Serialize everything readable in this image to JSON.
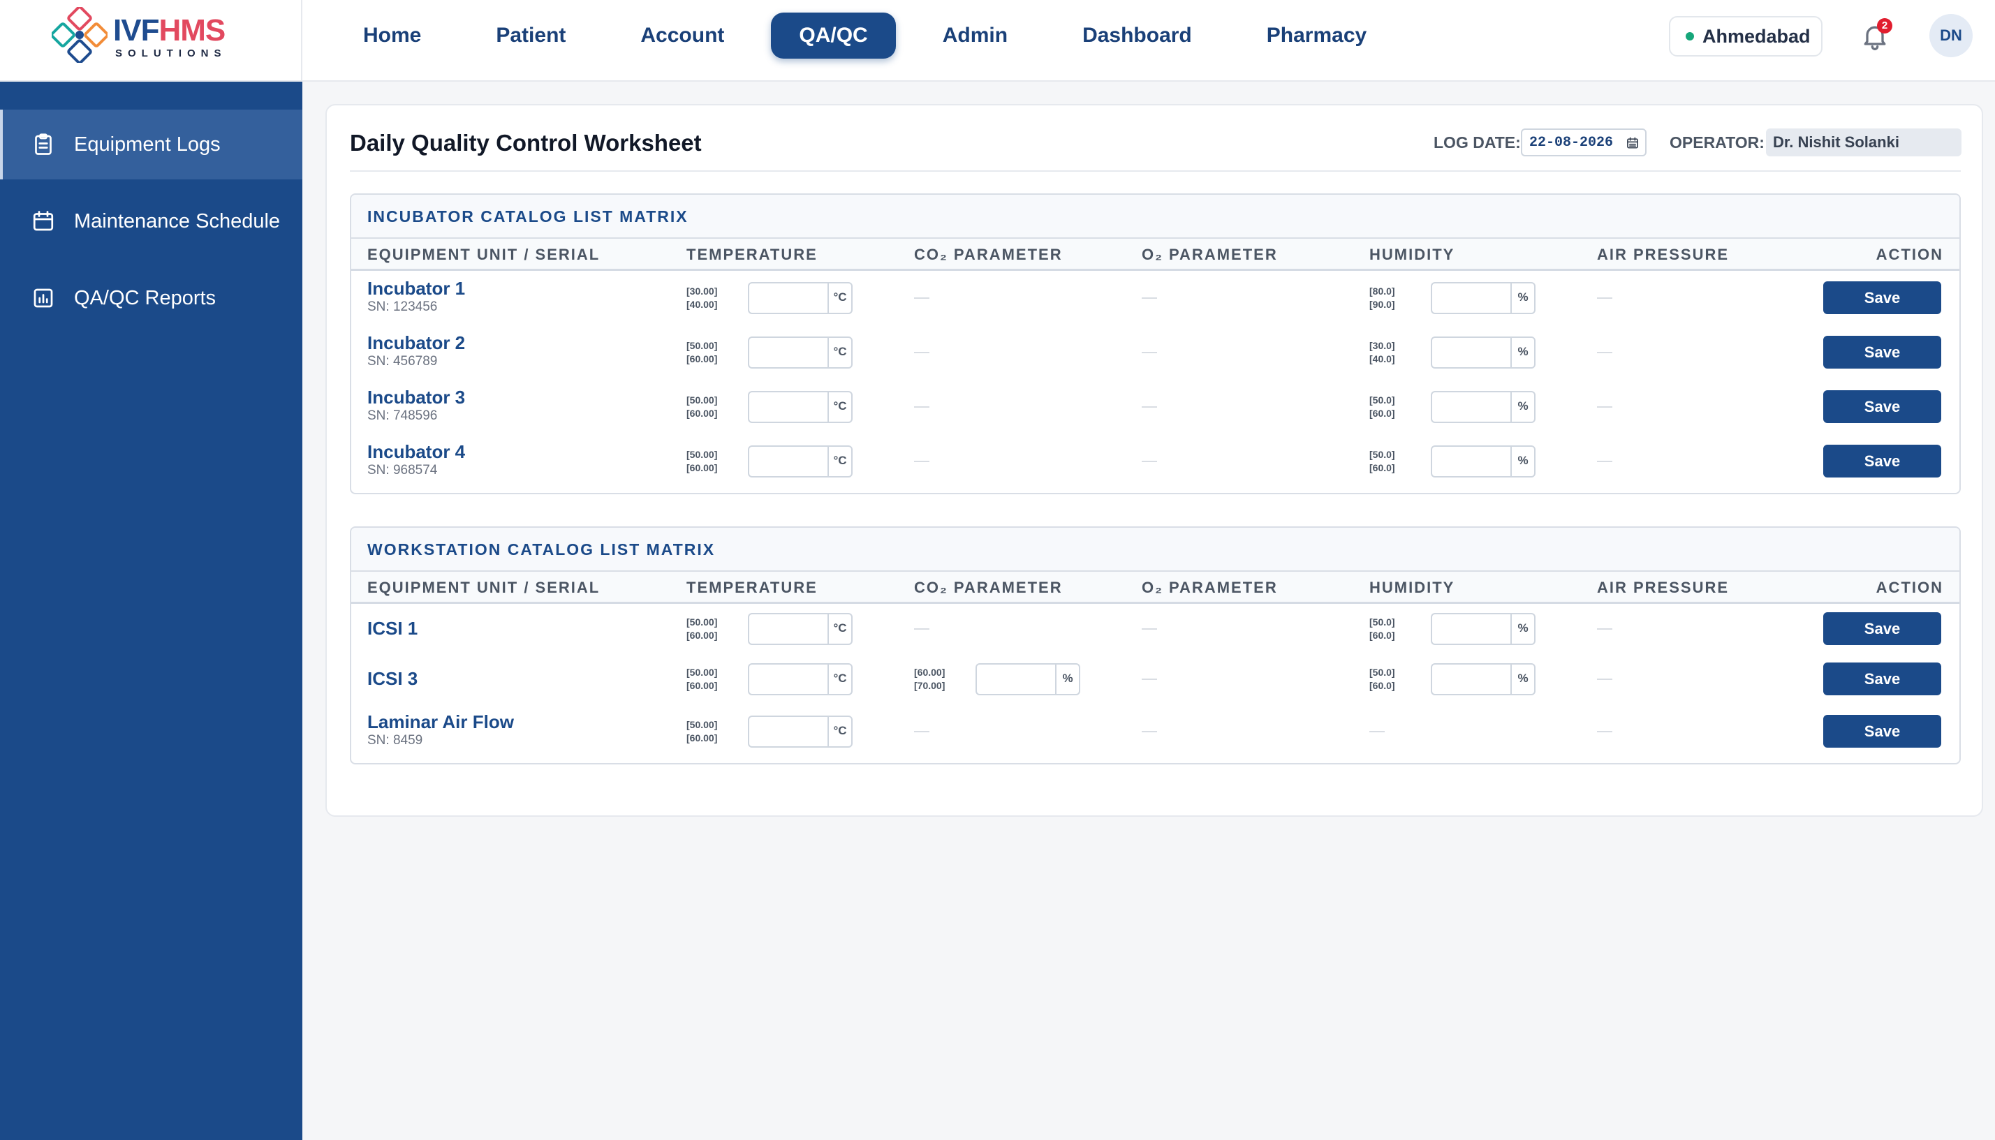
{
  "brand": {
    "main_1": "IVF",
    "main_2": "HMS",
    "sub": "SOLUTIONS"
  },
  "nav": [
    "Home",
    "Patient",
    "Account",
    "QA/QC",
    "Admin",
    "Dashboard",
    "Pharmacy"
  ],
  "nav_active": "QA/QC",
  "header": {
    "location": "Ahmedabad",
    "notifications": "2",
    "avatar": "DN",
    "location_dot_color": "#16a67a"
  },
  "sidebar": [
    {
      "label": "Equipment Logs",
      "icon": "clipboard-icon"
    },
    {
      "label": "Maintenance Schedule",
      "icon": "calendar-icon"
    },
    {
      "label": "QA/QC Reports",
      "icon": "report-chart-icon"
    }
  ],
  "sidebar_active": "Equipment Logs",
  "worksheet": {
    "title": "Daily Quality Control Worksheet",
    "log_date_label": "LOG DATE:",
    "log_date": "22-08-2026",
    "operator_label": "OPERATOR:",
    "operator": "Dr. Nishit Solanki"
  },
  "columns": [
    "EQUIPMENT UNIT / SERIAL",
    "TEMPERATURE",
    "CO₂ PARAMETER",
    "O₂ PARAMETER",
    "HUMIDITY",
    "AIR PRESSURE",
    "ACTION"
  ],
  "save_label": "Save",
  "sections": [
    {
      "title": "INCUBATOR CATALOG LIST MATRIX",
      "rows": [
        {
          "name": "Incubator 1",
          "sn": "SN: 123456",
          "temp_range": [
            "[30.00]",
            "[40.00]"
          ],
          "co2_range": null,
          "humidity_range": [
            "[80.0]",
            "[90.0]"
          ]
        },
        {
          "name": "Incubator 2",
          "sn": "SN: 456789",
          "temp_range": [
            "[50.00]",
            "[60.00]"
          ],
          "co2_range": null,
          "humidity_range": [
            "[30.0]",
            "[40.0]"
          ]
        },
        {
          "name": "Incubator 3",
          "sn": "SN: 748596",
          "temp_range": [
            "[50.00]",
            "[60.00]"
          ],
          "co2_range": null,
          "humidity_range": [
            "[50.0]",
            "[60.0]"
          ]
        },
        {
          "name": "Incubator 4",
          "sn": "SN: 968574",
          "temp_range": [
            "[50.00]",
            "[60.00]"
          ],
          "co2_range": null,
          "humidity_range": [
            "[50.0]",
            "[60.0]"
          ]
        }
      ]
    },
    {
      "title": "WORKSTATION CATALOG LIST MATRIX",
      "rows": [
        {
          "name": "ICSI 1",
          "sn": "",
          "temp_range": [
            "[50.00]",
            "[60.00]"
          ],
          "co2_range": null,
          "humidity_range": [
            "[50.0]",
            "[60.0]"
          ]
        },
        {
          "name": "ICSI 3",
          "sn": "",
          "temp_range": [
            "[50.00]",
            "[60.00]"
          ],
          "co2_range": [
            "[60.00]",
            "[70.00]"
          ],
          "humidity_range": [
            "[50.0]",
            "[60.0]"
          ]
        },
        {
          "name": "Laminar Air Flow",
          "sn": "SN: 8459",
          "temp_range": [
            "[50.00]",
            "[60.00]"
          ],
          "co2_range": null,
          "humidity_range": null
        }
      ]
    }
  ],
  "units": {
    "temperature": "°C",
    "percent": "%"
  }
}
